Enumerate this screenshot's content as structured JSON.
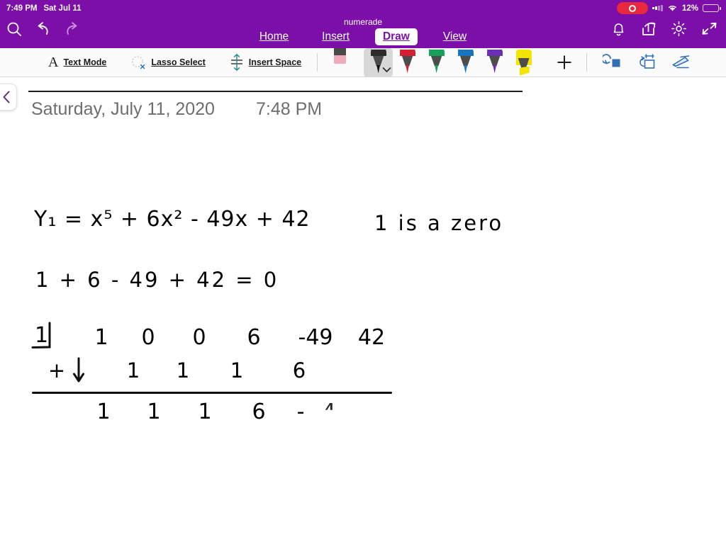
{
  "statusbar": {
    "time": "7:49 PM",
    "date": "Sat Jul 11",
    "battery_percent": "12%",
    "recording_icon": "record-pill-icon",
    "signal_icon": "cellular-signal-icon",
    "wifi_icon": "wifi-icon",
    "battery_icon": "battery-icon",
    "bar_color": "#7b0fa8"
  },
  "ribbon": {
    "doc_title": "numerade",
    "left_icons": [
      {
        "name": "search-icon",
        "label": "Search"
      },
      {
        "name": "undo-icon",
        "label": "Undo"
      },
      {
        "name": "redo-icon",
        "label": "Redo"
      }
    ],
    "right_icons": [
      {
        "name": "bell-icon",
        "label": "Notifications"
      },
      {
        "name": "share-icon",
        "label": "Share"
      },
      {
        "name": "gear-icon",
        "label": "Settings"
      },
      {
        "name": "collapse-ribbon-icon",
        "label": "Collapse"
      }
    ],
    "tabs": [
      {
        "label": "Home",
        "active": false
      },
      {
        "label": "Insert",
        "active": false
      },
      {
        "label": "Draw",
        "active": true
      },
      {
        "label": "View",
        "active": false
      }
    ]
  },
  "toolstrip": {
    "items": [
      {
        "icon": "text-mode-icon",
        "label": "Text Mode"
      },
      {
        "icon": "lasso-select-icon",
        "label": "Lasso Select"
      },
      {
        "icon": "insert-space-icon",
        "label": "Insert Space"
      }
    ],
    "pens": [
      {
        "name": "eraser",
        "type": "eraser",
        "color": "#f0a9bd",
        "selected": false
      },
      {
        "name": "pen-black",
        "type": "pen",
        "color": "#1c1c1c",
        "selected": true
      },
      {
        "name": "pen-red",
        "type": "pen",
        "color": "#d31f31",
        "selected": false
      },
      {
        "name": "pen-green",
        "type": "pen",
        "color": "#17a05a",
        "selected": false
      },
      {
        "name": "pen-blue",
        "type": "pen",
        "color": "#1874bd",
        "selected": false
      },
      {
        "name": "pen-purple",
        "type": "pen",
        "color": "#6a2fb5",
        "selected": false
      },
      {
        "name": "highlighter-yellow",
        "type": "highlighter",
        "color": "#f5e400",
        "selected": false
      }
    ],
    "add_pen_label": "+",
    "right_tools": [
      {
        "name": "ink-to-shape-icon",
        "label": "Ink to Shape"
      },
      {
        "name": "ink-replay-icon",
        "label": "Ink Replay"
      },
      {
        "name": "ink-eraser-pen-icon",
        "label": "Ink Editor"
      }
    ]
  },
  "canvas": {
    "back_button_icon": "chevron-left-icon",
    "page_date": "Saturday, July 11, 2020",
    "page_time": "7:48 PM",
    "notes": {
      "equation": "Y₁ = x⁵ + 6x² - 49x + 42",
      "side_note": "1 is a zero",
      "check_sum": "1 + 6 - 49 + 42 = 0",
      "synthetic_division": {
        "divisor": "1",
        "top_row": [
          "1",
          "0",
          "0",
          "6",
          "-49",
          "42"
        ],
        "middle_row_sign": "+",
        "middle_row": [
          "1",
          "1",
          "1",
          "6"
        ],
        "result_row": [
          "1",
          "1",
          "1",
          "6",
          "-",
          "4"
        ],
        "bracket_icon": "synthetic-division-bracket",
        "arrow_icon": "arrow-down-icon"
      }
    }
  }
}
